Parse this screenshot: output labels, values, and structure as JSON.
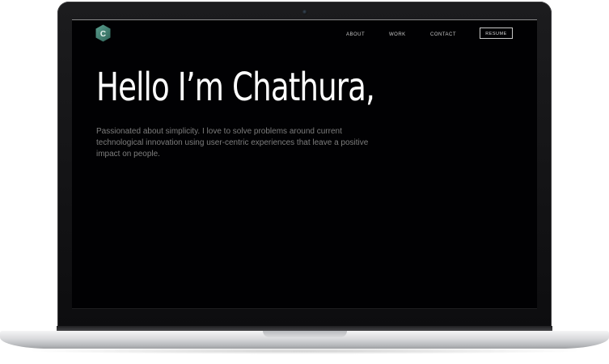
{
  "nav": {
    "about": "ABOUT",
    "work": "WORK",
    "contact": "CONTACT",
    "resume": "RESUME"
  },
  "logo": {
    "letter": "C",
    "color": "#3f7f72"
  },
  "hero": {
    "title": "Hello I’m Chathura,",
    "description": "Passionated about simplicity. I love to solve problems around current technological innovation using user-centric experiences that leave a positive impact on people."
  },
  "colors": {
    "screen_background": "#010103",
    "heading_text": "#ffffff",
    "body_text": "#7d7d7d",
    "accent": "#3f7f72"
  }
}
